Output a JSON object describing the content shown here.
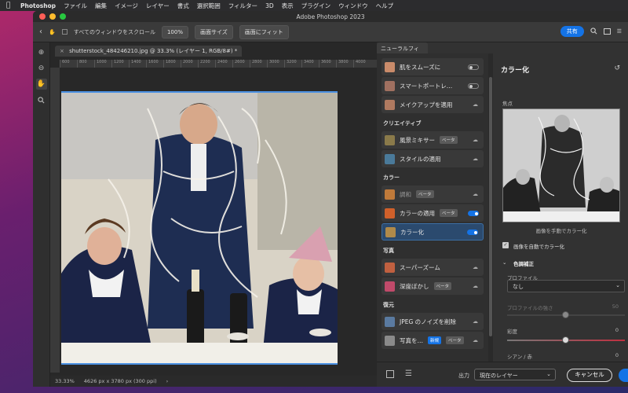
{
  "menubar": {
    "items": [
      "Photoshop",
      "ファイル",
      "編集",
      "イメージ",
      "レイヤー",
      "書式",
      "選択範囲",
      "フィルター",
      "3D",
      "表示",
      "プラグイン",
      "ウィンドウ",
      "ヘルプ"
    ]
  },
  "window": {
    "title": "Adobe Photoshop 2023"
  },
  "toolbar": {
    "scroll_all_label": "すべてのウィンドウをスクロール",
    "zoom_value": "100%",
    "fit_screen_label": "画面サイズ",
    "fill_screen_label": "画面にフィット",
    "share_label": "共有"
  },
  "document": {
    "tab_title": "shutterstock_484246210.jpg @ 33.3% (レイヤー 1, RGB/8#) *",
    "ruler_ticks": [
      "600",
      "800",
      "1000",
      "1200",
      "1400",
      "1600",
      "1800",
      "2000",
      "2200",
      "2400",
      "2600",
      "2800",
      "3000",
      "3200",
      "3400",
      "3600",
      "3800",
      "4000"
    ],
    "status_zoom": "33.33%",
    "status_info": "4626 px x 3780 px (300 ppi)"
  },
  "neural": {
    "tab_label": "ニューラルフィルター",
    "sections": [
      {
        "title": "",
        "items": [
          {
            "label": "肌をスムーズに",
            "control": "toggle-off",
            "color": "#c98b6a"
          },
          {
            "label": "スマートポートレ…",
            "control": "toggle-off",
            "color": "#a07060"
          },
          {
            "label": "メイクアップを適用",
            "control": "cloud",
            "color": "#b07a60"
          }
        ]
      },
      {
        "title": "クリエイティブ",
        "items": [
          {
            "label": "風景ミキサー",
            "badge": "ベータ",
            "control": "cloud",
            "color": "#8a7a4a"
          },
          {
            "label": "スタイルの適用",
            "control": "cloud",
            "color": "#4a7a9a"
          }
        ]
      },
      {
        "title": "カラー",
        "items": [
          {
            "label": "調和",
            "badge": "ベータ",
            "control": "cloud",
            "color": "#c07a3a",
            "dim": true
          },
          {
            "label": "カラーの適用",
            "badge": "ベータ",
            "control": "toggle-on",
            "color": "#d0602a"
          },
          {
            "label": "カラー化",
            "control": "toggle-on",
            "color": "#b08a4a",
            "selected": true
          }
        ]
      },
      {
        "title": "写真",
        "items": [
          {
            "label": "スーパーズーム",
            "control": "cloud",
            "color": "#c06040"
          },
          {
            "label": "深度ぼかし",
            "badge": "ベータ",
            "control": "cloud",
            "color": "#c04a6a"
          }
        ]
      },
      {
        "title": "復元",
        "items": [
          {
            "label": "JPEG のノイズを削除",
            "control": "cloud",
            "color": "#5a7aa0"
          },
          {
            "label": "写真を…",
            "badge": "新規",
            "badge2": "ベータ",
            "control": "cloud",
            "color": "#8a8a8a"
          }
        ]
      }
    ]
  },
  "settings": {
    "title": "カラー化",
    "focal_label": "焦点",
    "manual_caption": "画像を手動でカラー化",
    "auto_label": "画像を自動でカラー化",
    "tone_label": "色調補正",
    "profile_label": "プロファイル",
    "profile_value": "なし",
    "profile_strength_label": "プロファイルの強さ",
    "profile_strength_value": "50",
    "saturation_label": "彩度",
    "saturation_value": "0",
    "cyan_red_label": "シアン / 赤",
    "cyan_red_value": "0"
  },
  "footer": {
    "output_label": "出力",
    "output_value": "現在のレイヤー",
    "cancel_label": "キャンセル",
    "ok_label": "OK"
  }
}
